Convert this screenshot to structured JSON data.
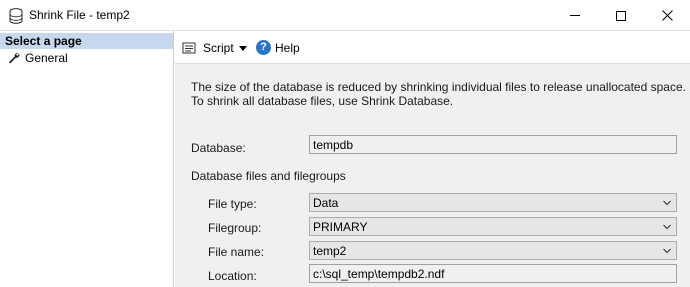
{
  "window": {
    "title": "Shrink File - temp2",
    "controls": {
      "minimize": "minimize-icon",
      "maximize": "maximize-icon",
      "close": "close-icon"
    }
  },
  "left_pane": {
    "header": "Select a page",
    "items": [
      {
        "label": "General",
        "icon": "wrench-icon",
        "selected": true
      }
    ]
  },
  "toolbar": {
    "script_label": "Script",
    "help_label": "Help"
  },
  "main": {
    "description": "The size of the database is reduced by shrinking individual files to release unallocated space. To shrink all database files, use Shrink Database.",
    "database": {
      "label": "Database:",
      "value": "tempdb"
    },
    "section_label": "Database files and filegroups",
    "file_type": {
      "label": "File type:",
      "value": "Data"
    },
    "filegroup": {
      "label": "Filegroup:",
      "value": "PRIMARY"
    },
    "file_name": {
      "label": "File name:",
      "value": "temp2"
    },
    "location": {
      "label": "Location:",
      "value": "c:\\sql_temp\\tempdb2.ndf"
    }
  },
  "colors": {
    "selected_header_bg": "#c7d7ee",
    "content_bg": "#f0f0f0",
    "help_icon": "#2a74c9"
  }
}
